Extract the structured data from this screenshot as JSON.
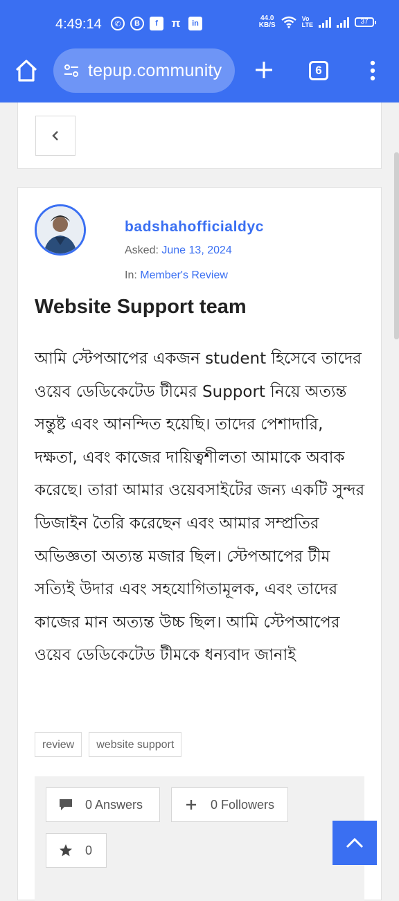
{
  "status_bar": {
    "time": "4:49:14",
    "net_speed_value": "44.0",
    "net_speed_unit": "KB/S",
    "volte_top": "Vo",
    "volte_bottom": "LTE",
    "battery": "37",
    "app_icons": [
      "whatsapp-icon",
      "b-app-icon",
      "facebook-icon",
      "pi-icon",
      "linkedin-icon"
    ]
  },
  "browser": {
    "url": "tepup.community",
    "tab_count": "6"
  },
  "question": {
    "author": "badshahofficialdyc",
    "asked_label": "Asked:",
    "asked_date": "June 13, 2024",
    "in_label": "In:",
    "category": "Member's Review",
    "title": "Website Support team",
    "body": "আমি স্টেপআপের একজন student হিসেবে তাদের ওয়েব ডেডিকেটেড টীমের Support নিয়ে অত্যন্ত সন্তুষ্ট এবং আনন্দিত হয়েছি। তাদের পেশাদারি, দক্ষতা, এবং কাজের দায়িত্বশীলতা আমাকে অবাক করেছে। তারা আমার ওয়েবসাইটের জন্য একটি সুন্দর ডিজাইন তৈরি করেছেন এবং আমার সম্প্রতির অভিজ্ঞতা অত্যন্ত মজার ছিল। স্টেপআপের টীম সত্যিই উদার এবং সহযোগিতামূলক, এবং তাদের কাজের মান অত্যন্ত উচ্চ ছিল। আমি স্টেপআপের ওয়েব ডেডিকেটেড টীমকে ধন্যবাদ জানাই",
    "tags": [
      "review",
      "website support"
    ],
    "answers": "0 Answers",
    "followers": "0 Followers",
    "votes": "0"
  },
  "colors": {
    "brand_blue": "#3a6ff2",
    "url_pill": "#6e95f6",
    "page_bg": "#f1f1f1"
  }
}
